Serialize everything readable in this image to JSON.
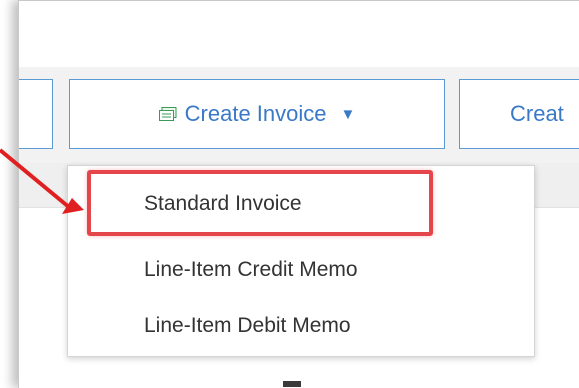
{
  "toolbar": {
    "create_invoice_label": "Create Invoice",
    "next_button_label": "Creat",
    "caret": "▼"
  },
  "dropdown": {
    "items": [
      {
        "label": "Standard Invoice"
      },
      {
        "label": "Line-Item Credit Memo"
      },
      {
        "label": "Line-Item Debit Memo"
      }
    ]
  },
  "colors": {
    "accent": "#3a79c8",
    "highlight": "#e4464b",
    "arrow": "#e02020"
  }
}
